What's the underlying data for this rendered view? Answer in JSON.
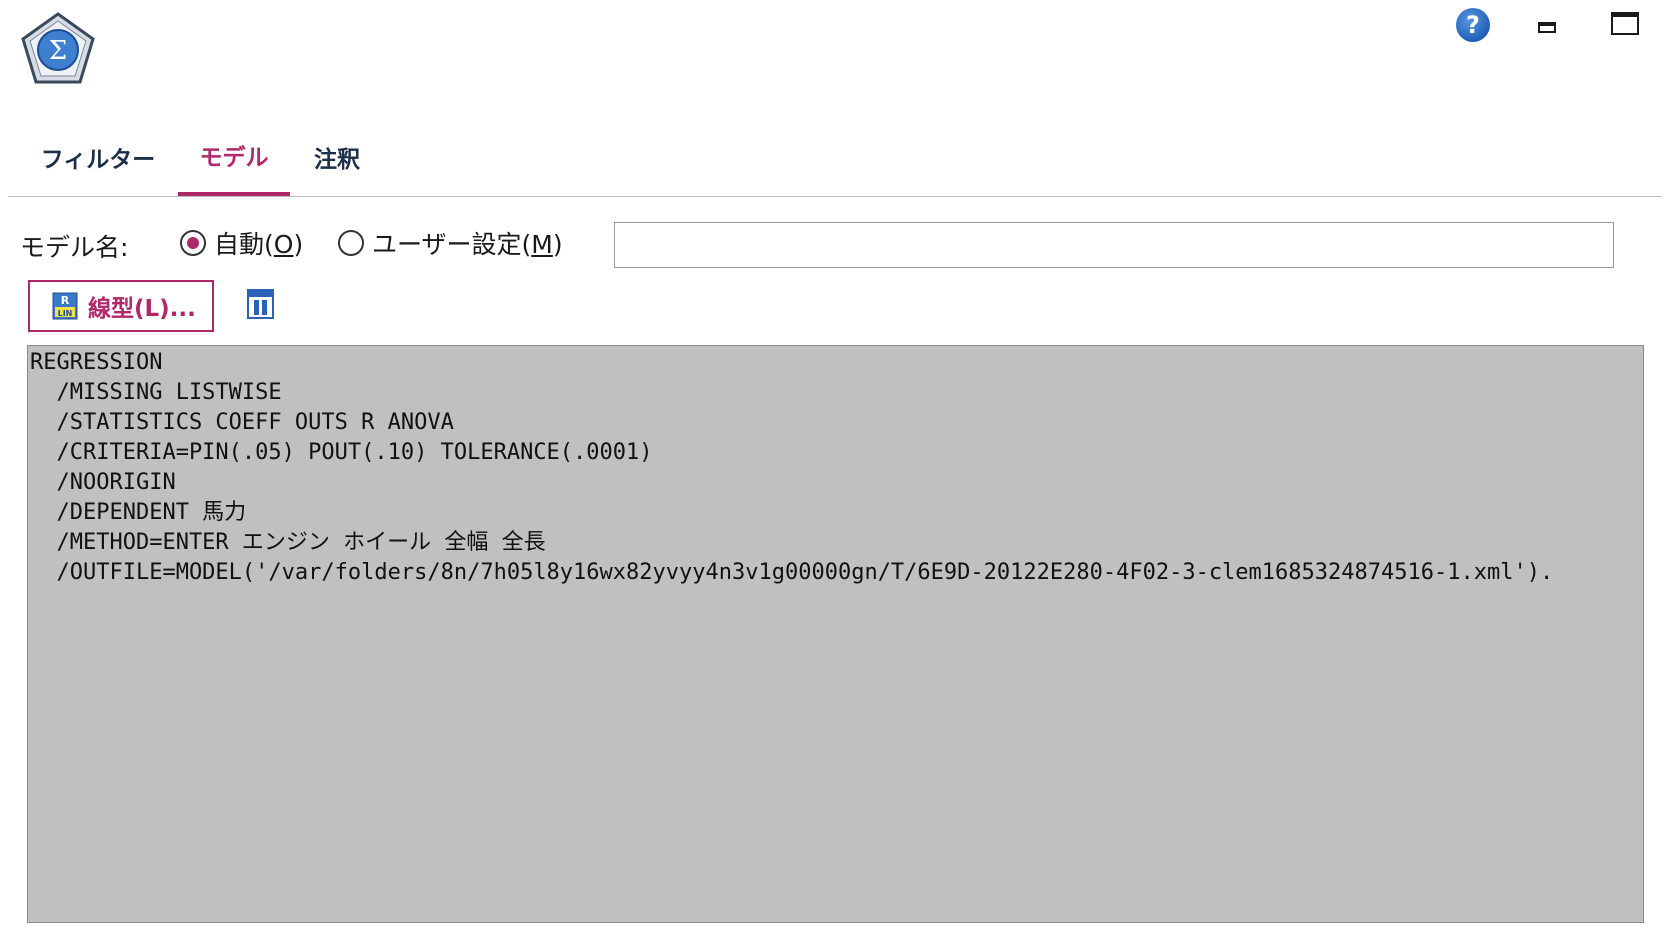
{
  "app": {
    "icon": "sigma-pentagon-icon",
    "icon_glyph": "Σ"
  },
  "window_controls": {
    "help_glyph": "?",
    "help_icon": "help-icon",
    "minimize_icon": "minimize-icon",
    "maximize_icon": "maximize-icon"
  },
  "tabs": [
    {
      "label": "フィルター",
      "active": false
    },
    {
      "label": "モデル",
      "active": true
    },
    {
      "label": "注釈",
      "active": false
    }
  ],
  "model_name": {
    "label": "モデル名:",
    "options": [
      {
        "text": "自動(",
        "mnemonic": "O",
        "suffix": ")",
        "checked": true
      },
      {
        "text": "ユーザー設定(",
        "mnemonic": "M",
        "suffix": ")",
        "checked": false
      }
    ],
    "custom_value": ""
  },
  "toolbar": {
    "linear_button_label": "線型(L)...",
    "linear_icon": "regression-linear-icon",
    "table_icon": "table-view-icon"
  },
  "syntax": {
    "lines": [
      "REGRESSION",
      "  /MISSING LISTWISE",
      "  /STATISTICS COEFF OUTS R ANOVA",
      "  /CRITERIA=PIN(.05) POUT(.10) TOLERANCE(.0001)",
      "  /NOORIGIN",
      "  /DEPENDENT 馬力",
      "  /METHOD=ENTER エンジン ホイール 全幅 全長",
      "  /OUTFILE=MODEL('/var/folders/8n/7h05l8y16wx82yvyy4n3v1g00000gn/T/6E9D-20122E280-4F02-3-clem1685324874516-1.xml')."
    ]
  },
  "colors": {
    "accent": "#b0286a",
    "syntax_bg": "#c0c0c0",
    "tab_text": "#1c2f4a"
  }
}
